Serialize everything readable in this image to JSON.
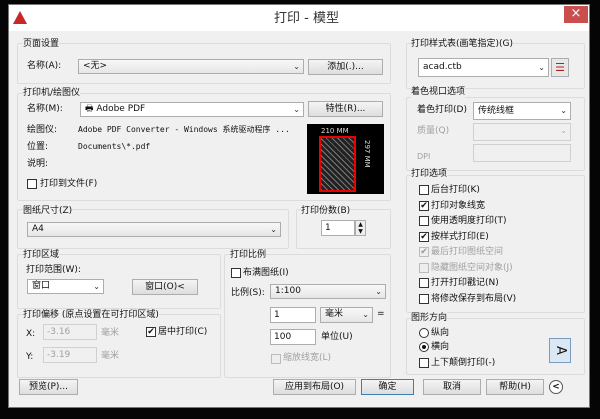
{
  "window": {
    "title": "打印 - 模型",
    "close": "×"
  },
  "page_setup": {
    "group": "页面设置",
    "name_label": "名称(A):",
    "name_value": "<无>",
    "add_button": "添加(.)..."
  },
  "printer": {
    "group": "打印机/绘图仪",
    "name_label": "名称(M):",
    "name_value": "Adobe PDF",
    "properties_button": "特性(R)...",
    "plotter_label": "绘图仪:",
    "plotter_value": "Adobe PDF Converter - Windows 系统驱动程序 ...",
    "location_label": "位置:",
    "location_value": "Documents\\*.pdf",
    "description_label": "说明:",
    "print_to_file": "打印到文件(F)",
    "print_to_file_checked": false,
    "preview_width": "210 MM",
    "preview_height": "297 MM"
  },
  "paper_size": {
    "group": "图纸尺寸(Z)",
    "value": "A4"
  },
  "copies": {
    "group": "打印份数(B)",
    "value": "1"
  },
  "plot_area": {
    "group": "打印区域",
    "range_label": "打印范围(W):",
    "range_value": "窗口",
    "window_button": "窗口(O)<"
  },
  "plot_offset": {
    "group": "打印偏移 (原点设置在可打印区域)",
    "x_label": "X:",
    "x_value": "-3.16",
    "x_unit": "毫米",
    "y_label": "Y:",
    "y_value": "-3.19",
    "y_unit": "毫米",
    "center": "居中打印(C)",
    "center_checked": true
  },
  "plot_scale": {
    "group": "打印比例",
    "fit": "布满图纸(I)",
    "fit_checked": false,
    "scale_label": "比例(S):",
    "scale_value": "1:100",
    "mm_value": "1",
    "mm_unit": "毫米",
    "equals": "=",
    "units_value": "100",
    "units_label": "单位(U)",
    "scale_lineweights": "缩放线宽(L)"
  },
  "plot_style": {
    "group": "打印样式表(画笔指定)(G)",
    "value": "acad.ctb"
  },
  "shaded": {
    "group": "着色视口选项",
    "shade_label": "着色打印(D)",
    "shade_value": "传统线框",
    "quality_label": "质量(Q)",
    "dpi_label": "DPI"
  },
  "options": {
    "group": "打印选项",
    "items": [
      {
        "label": "后台打印(K)",
        "checked": false,
        "disabled": false
      },
      {
        "label": "打印对象线宽",
        "checked": true,
        "disabled": false
      },
      {
        "label": "使用透明度打印(T)",
        "checked": false,
        "disabled": false
      },
      {
        "label": "按样式打印(E)",
        "checked": true,
        "disabled": false
      },
      {
        "label": "最后打印图纸空间",
        "checked": true,
        "disabled": true
      },
      {
        "label": "隐藏图纸空间对象(J)",
        "checked": false,
        "disabled": true
      },
      {
        "label": "打开打印戳记(N)",
        "checked": false,
        "disabled": false
      },
      {
        "label": "将修改保存到布局(V)",
        "checked": false,
        "disabled": false
      }
    ]
  },
  "orientation": {
    "group": "图形方向",
    "portrait": "纵向",
    "landscape": "横向",
    "selected": "横向",
    "upside_down": "上下颠倒打印(-)",
    "icon_letter": "A"
  },
  "footer": {
    "preview": "预览(P)...",
    "apply": "应用到布局(O)",
    "ok": "确定",
    "cancel": "取消",
    "help": "帮助(H)",
    "collapse": "<"
  }
}
